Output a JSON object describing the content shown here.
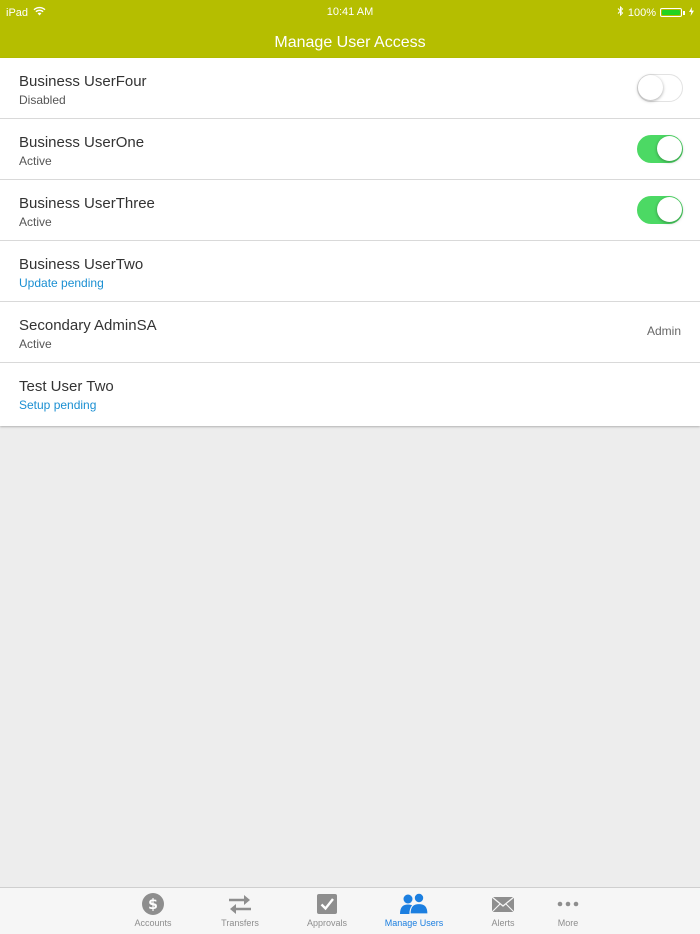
{
  "status_bar": {
    "device": "iPad",
    "time": "10:41 AM",
    "battery": "100%"
  },
  "header": {
    "title": "Manage User Access"
  },
  "users": [
    {
      "name": "Business UserFour",
      "status": "Disabled",
      "toggle": "off"
    },
    {
      "name": "Business UserOne",
      "status": "Active",
      "toggle": "on"
    },
    {
      "name": "Business UserThree",
      "status": "Active",
      "toggle": "on"
    },
    {
      "name": "Business UserTwo",
      "status": "Update pending"
    },
    {
      "name": "Secondary AdminSA",
      "status": "Active",
      "role": "Admin"
    },
    {
      "name": "Test User Two",
      "status": "Setup pending"
    }
  ],
  "tabs": [
    {
      "label": "Accounts",
      "icon": "dollar-icon"
    },
    {
      "label": "Transfers",
      "icon": "transfer-arrows-icon"
    },
    {
      "label": "Approvals",
      "icon": "checkbox-icon"
    },
    {
      "label": "Manage Users",
      "icon": "users-icon",
      "active": true
    },
    {
      "label": "Alerts",
      "icon": "envelope-icon"
    },
    {
      "label": "More",
      "icon": "more-dots-icon"
    }
  ],
  "colors": {
    "header": "#b5be00",
    "toggle_on": "#4cd964",
    "pending_text": "#1a8fd2",
    "active_tab": "#1c7fe0"
  }
}
